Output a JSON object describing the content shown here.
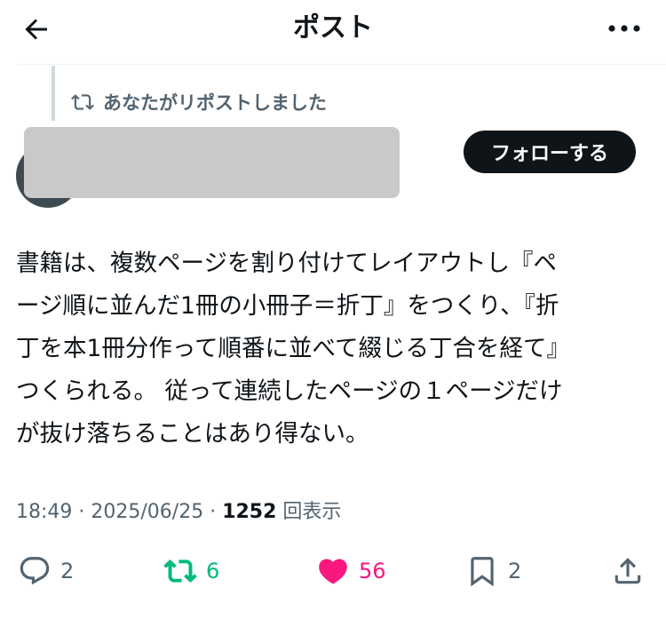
{
  "header": {
    "title": "ポスト"
  },
  "repost_context": {
    "text": "あなたがリポストしました"
  },
  "author": {
    "follow_label": "フォローする"
  },
  "post": {
    "lines": [
      "書籍は、複数ページを割り付けてレイアウトし『ペ",
      "ージ順に並んだ1冊の小冊子＝折丁』をつくり、『折",
      "丁を本1冊分作って順番に並べて綴じる丁合を経て』",
      "つくられる。 従って連続したページの１ページだけ",
      "が抜け落ちることはあり得ない。"
    ]
  },
  "meta": {
    "time": "18:49",
    "sep1": " · ",
    "date": "2025/06/25",
    "sep2": " · ",
    "views_count": "1252",
    "views_label": " 回表示"
  },
  "actions": {
    "reply_count": "2",
    "repost_count": "6",
    "like_count": "56",
    "bookmark_count": "2"
  },
  "colors": {
    "repost_active": "#00ba7c",
    "like_active": "#f91880",
    "follow_button": "#0f1419",
    "muted": "#536471"
  }
}
